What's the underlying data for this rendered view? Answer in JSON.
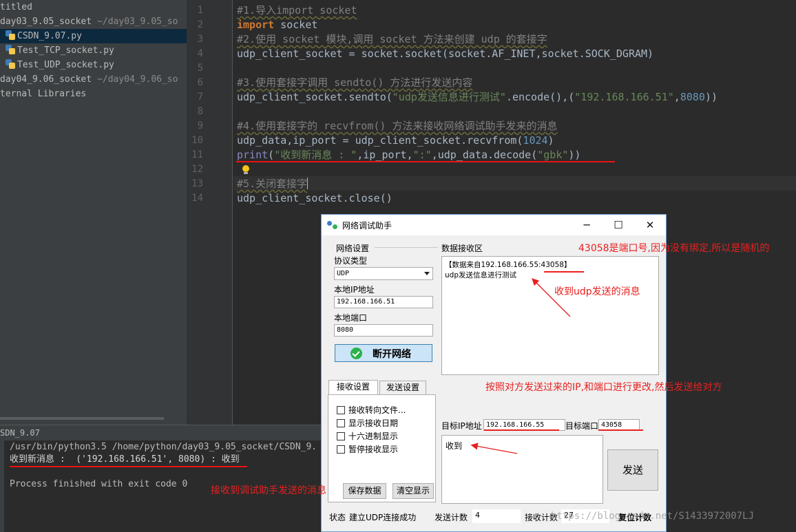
{
  "project": {
    "rows": [
      {
        "name": "titled",
        "path": ""
      },
      {
        "name": "day03_9.05_socket",
        "path": "~/day03_9.05_so"
      },
      {
        "name": "CSDN_9.07.py",
        "path": ""
      },
      {
        "name": "Test_TCP_socket.py",
        "path": ""
      },
      {
        "name": "Test_UDP_socket.py",
        "path": ""
      },
      {
        "name": "day04_9.06_socket",
        "path": "~/day04_9.06_so"
      },
      {
        "name": "ternal Libraries",
        "path": ""
      }
    ]
  },
  "editor": {
    "line_numbers": [
      "1",
      "2",
      "3",
      "4",
      "5",
      "6",
      "7",
      "8",
      "9",
      "10",
      "11",
      "12",
      "13",
      "14"
    ],
    "comment_1": "#1.导入import socket",
    "kw_import": "import",
    "import_target": " socket",
    "comment_2": "#2.使用 socket 模块,调用 socket 方法来创建 udp 的套接字",
    "line4": "udp_client_socket = socket.socket(socket.AF_INET,socket.SOCK_DGRAM)",
    "comment_3": "#3.使用套接字调用 sendto() 方法进行发送内容",
    "line7_a": "udp_client_socket.sendto(",
    "line7_str1": "\"udp发送信息进行测试\"",
    "line7_b": ".encode(),(",
    "line7_str2": "\"192.168.166.51\"",
    "line7_c": ",",
    "line7_num": "8080",
    "line7_d": "))",
    "comment_4": "#4.使用套接字的 recvfrom() 方法来接收网络调试助手发来的消息",
    "line10_a": "udp_data,ip_port = udp_client_socket.recvfrom(",
    "line10_num": "1024",
    "line10_b": ")",
    "line11_fn": "print",
    "line11_a": "(",
    "line11_str1": "\"收到新消息 : \"",
    "line11_b": ",ip_port,",
    "line11_str2": "\":\"",
    "line11_c": ",udp_data.decode(",
    "line11_str3": "\"gbk\"",
    "line11_d": "))",
    "comment_5": "#5.关闭套接字",
    "line14": "udp_client_socket.close()"
  },
  "run": {
    "tab_label": "SDN_9.07",
    "cmd": "/usr/bin/python3.5 /home/python/day03_9.05_socket/CSDN_9.",
    "output": "收到新消息 :  ('192.168.166.51', 8080) : 收到",
    "exit": "Process finished with exit code 0"
  },
  "dialog": {
    "title": "网络调试助手",
    "minimize": "─",
    "maximize": "☐",
    "close": "✕",
    "net_settings": "网络设置",
    "protocol_label": "协议类型",
    "protocol_value": "UDP",
    "local_ip_label": "本地IP地址",
    "local_ip": "192.168.166.51",
    "local_port_label": "本地端口",
    "local_port": "8080",
    "disconnect": "断开网络",
    "tab_recv": "接收设置",
    "tab_send": "发送设置",
    "options": [
      "接收转向文件...",
      "显示接收日期",
      "十六进制显示",
      "暂停接收显示"
    ],
    "save_data": "保存数据",
    "clear_display": "清空显示",
    "recv_area_label": "数据接收区",
    "recv_header_prefix": "【数据来自192.168.166.55:",
    "recv_port": "43058",
    "recv_header_suffix": "】",
    "recv_body": "udp发送信息进行测试",
    "target_ip_label": "目标IP地址",
    "target_ip": "192.168.166.55",
    "target_port_label": "目标端口",
    "target_port": "43058",
    "send_text": "收到",
    "send_btn": "发送",
    "status_label": "状态",
    "status_text": "建立UDP连接成功",
    "send_count_label": "发送计数",
    "send_count": "4",
    "recv_count_label": "接收计数",
    "recv_count": "27",
    "reset_count": "复位计数"
  },
  "annotations": {
    "port_note": "43058是端口号,因为没有绑定,所以是随机的",
    "udp_recv_note": "收到udp发送的消息",
    "reply_note": "按照对方发送过来的IP,和端口进行更改,然后发送给对方",
    "assistant_note": "接收到调试助手发送的消息"
  },
  "watermark": "https://blog.csdn.net/S1433972007LJ",
  "colors": {
    "annotation": "#e8201f",
    "comment": "#808080",
    "keyword": "#cc7832",
    "string": "#6a8759",
    "number": "#6897bb"
  }
}
